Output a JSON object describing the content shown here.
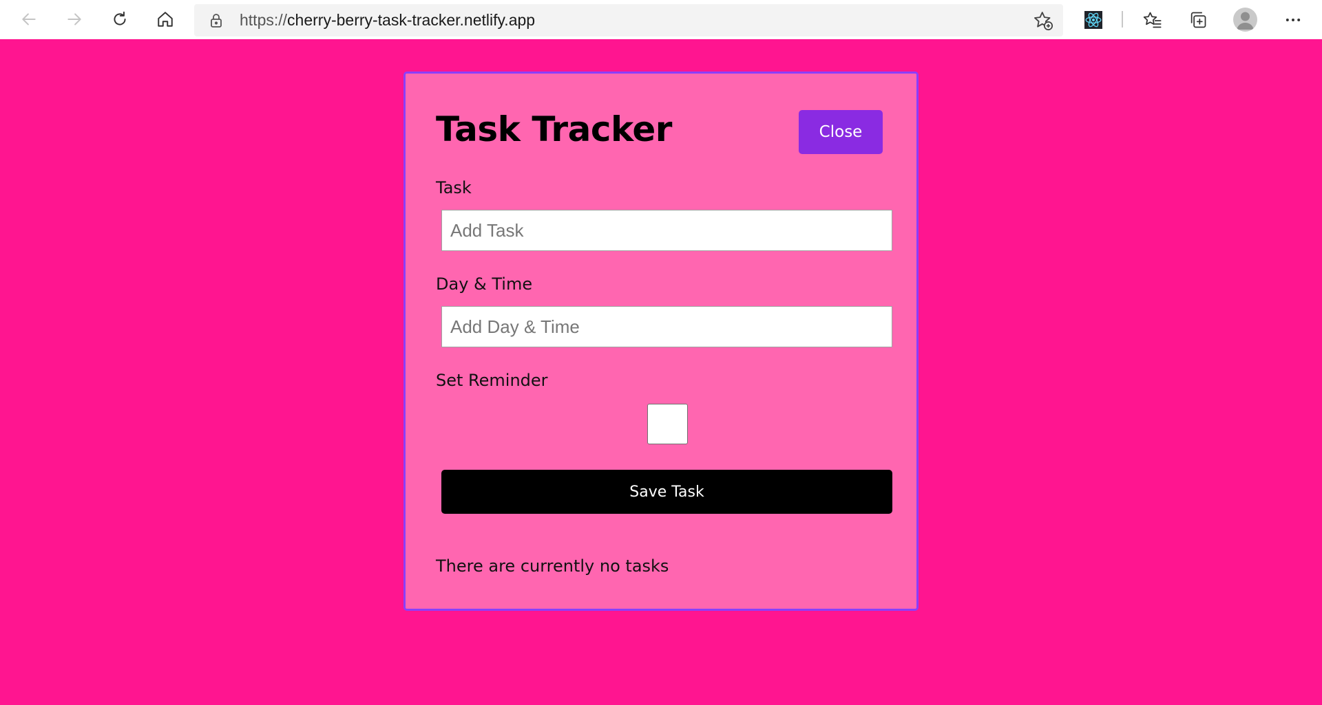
{
  "browser": {
    "url_scheme": "https://",
    "url_host": "cherry-berry-task-tracker.netlify.app",
    "icons": {
      "back": "arrow-left-icon",
      "forward": "arrow-right-icon",
      "refresh": "refresh-icon",
      "home": "home-icon",
      "lock": "lock-icon",
      "add_favorite": "star-plus-icon",
      "extension": "react-devtools-icon",
      "favorites": "favorites-icon",
      "collections": "collections-icon",
      "profile": "profile-icon",
      "menu": "more-icon"
    }
  },
  "app": {
    "title": "Task Tracker",
    "close_label": "Close",
    "form": {
      "task_label": "Task",
      "task_placeholder": "Add Task",
      "task_value": "",
      "day_label": "Day & Time",
      "day_placeholder": "Add Day & Time",
      "day_value": "",
      "reminder_label": "Set Reminder",
      "reminder_checked": false,
      "save_label": "Save Task"
    },
    "empty_message": "There are currently no tasks"
  },
  "colors": {
    "page_background": "#ff1590",
    "card_background": "#ff66b0",
    "card_border": "#8a3fff",
    "close_button": "#8a2be2",
    "save_button": "#000000"
  }
}
